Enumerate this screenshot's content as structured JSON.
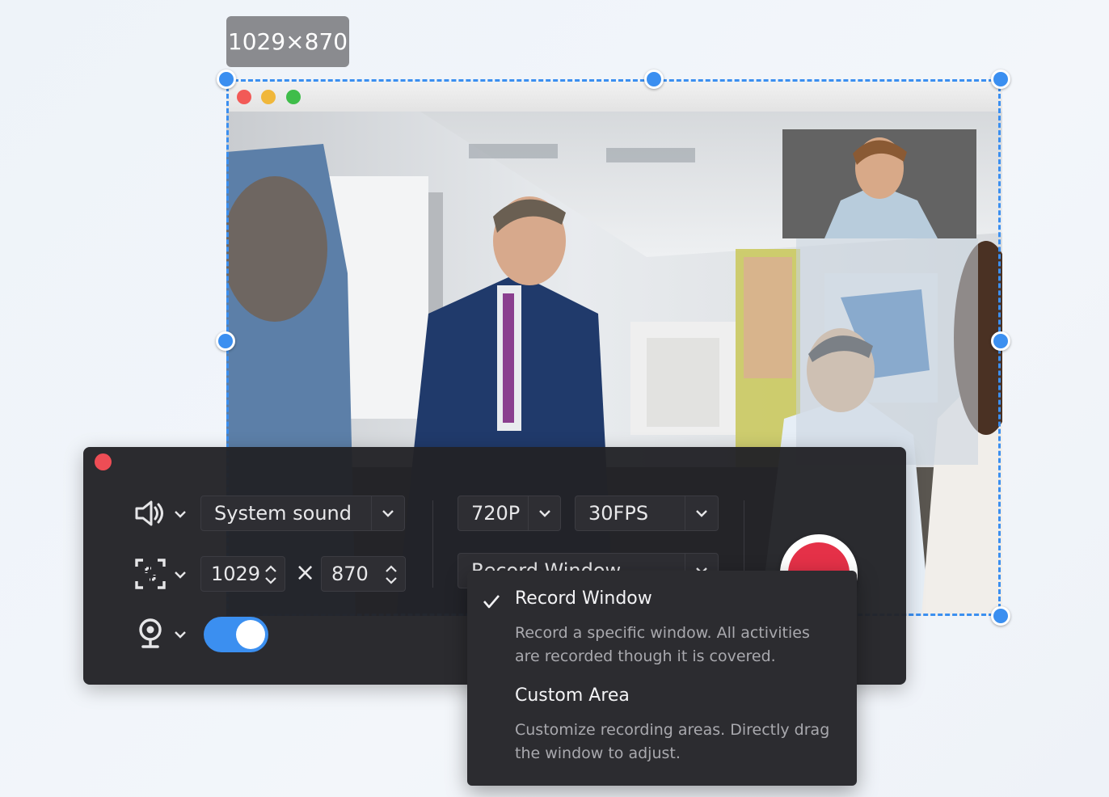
{
  "capture": {
    "size_label": "1029×870"
  },
  "recorder": {
    "audio": {
      "source_value": "System sound"
    },
    "region": {
      "width_value": "1029",
      "times_symbol": "×",
      "height_value": "870"
    },
    "webcam": {
      "enabled": true
    },
    "quality": {
      "resolution_value": "720P",
      "fps_value": "30FPS"
    },
    "mode": {
      "selected_value": "Record Window"
    }
  },
  "mode_menu": {
    "items": [
      {
        "title": "Record Window",
        "description": "Record a specific window. All activities are recorded though it is covered.",
        "selected": true
      },
      {
        "title": "Custom Area",
        "description": "Customize recording areas. Directly drag the window to adjust.",
        "selected": false
      }
    ]
  },
  "colors": {
    "accent": "#3b8ff0",
    "record": "#e53148",
    "panel": "#222226"
  },
  "icons": [
    "speaker-icon",
    "region-select-icon",
    "webcam-icon",
    "chevron-down-icon",
    "stepper-icon",
    "checkmark-icon",
    "window-close-icon"
  ]
}
